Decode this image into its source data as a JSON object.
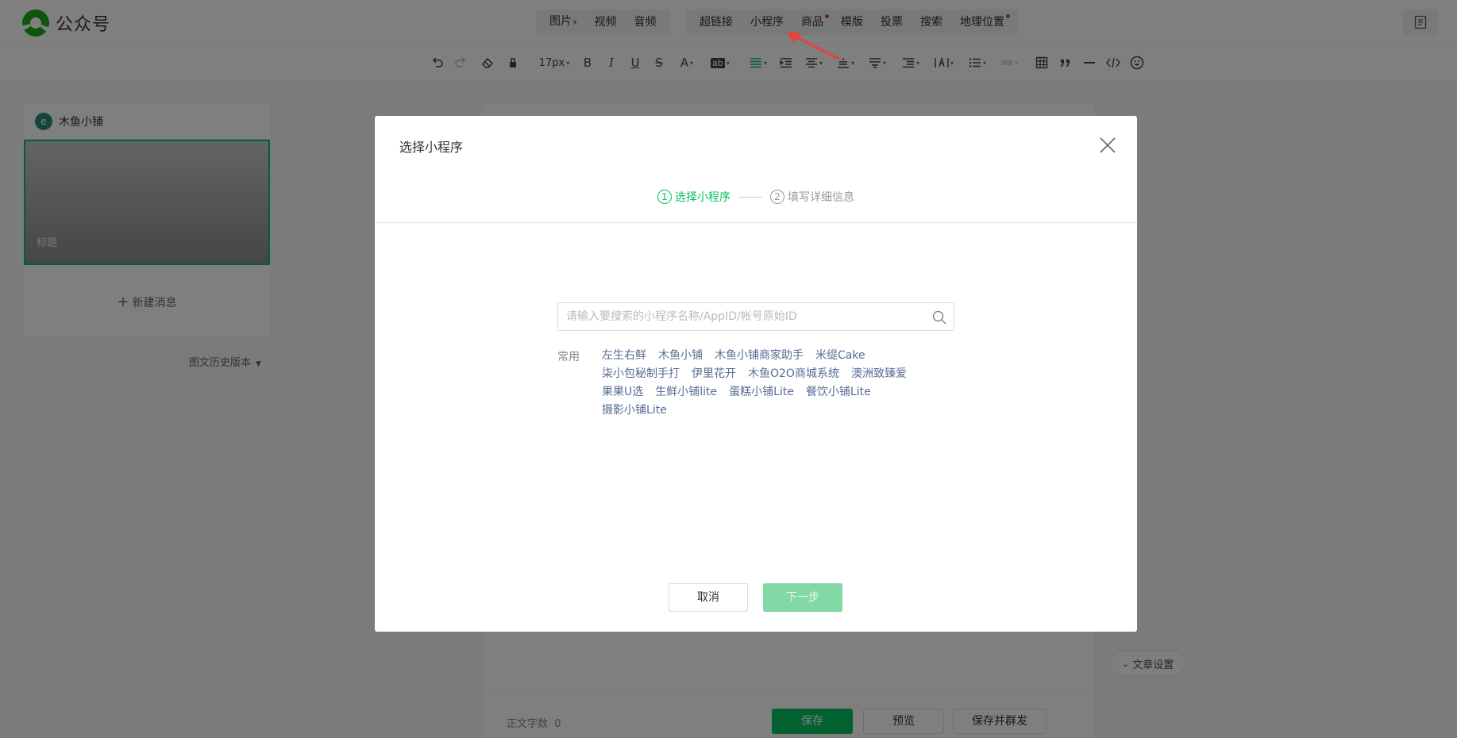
{
  "app": {
    "name": "公众号"
  },
  "topnav": {
    "group1": [
      {
        "label": "图片",
        "caret": true
      },
      {
        "label": "视频"
      },
      {
        "label": "音频"
      }
    ],
    "group2": [
      {
        "label": "超链接"
      },
      {
        "label": "小程序"
      },
      {
        "label": "商品",
        "dot": true
      },
      {
        "label": "模版"
      },
      {
        "label": "投票"
      },
      {
        "label": "搜索"
      },
      {
        "label": "地理位置",
        "dot": true
      }
    ]
  },
  "toolbar": {
    "font_size": "17px",
    "bold": "B",
    "italic": "I",
    "underline": "U",
    "strike": "S",
    "font_color": "A",
    "bg_color": "ab"
  },
  "account": {
    "name": "木鱼小铺"
  },
  "cover": {
    "title_placeholder": "标题"
  },
  "new_message": "新建消息",
  "history_label": "图文历史版本",
  "article_settings": "文章设置",
  "bottombar": {
    "wordcount_label": "正文字数",
    "wordcount_value": "0",
    "save": "保存",
    "preview": "预览",
    "save_publish": "保存并群发"
  },
  "modal": {
    "title": "选择小程序",
    "steps": [
      {
        "num": "1",
        "label": "选择小程序",
        "active": true
      },
      {
        "num": "2",
        "label": "填写详细信息",
        "active": false
      }
    ],
    "search_placeholder": "请输入要搜索的小程序名称/AppID/帐号原始ID",
    "common_label": "常用",
    "common_items": [
      "左生右鲜",
      "木鱼小铺",
      "木鱼小铺商家助手",
      "米缇Cake",
      "柒小包秘制手打",
      "伊里花开",
      "木鱼O2O商城系统",
      "澳洲致臻爱",
      "果果U选",
      "生鲜小铺lite",
      "蛋糕小铺Lite",
      "餐饮小铺Lite",
      "摄影小铺Lite"
    ],
    "cancel": "取消",
    "next": "下一步"
  },
  "colors": {
    "brand_green": "#07c160",
    "link_blue": "#576b95",
    "dot_red": "#e64340",
    "arrow_red": "#e64340"
  }
}
